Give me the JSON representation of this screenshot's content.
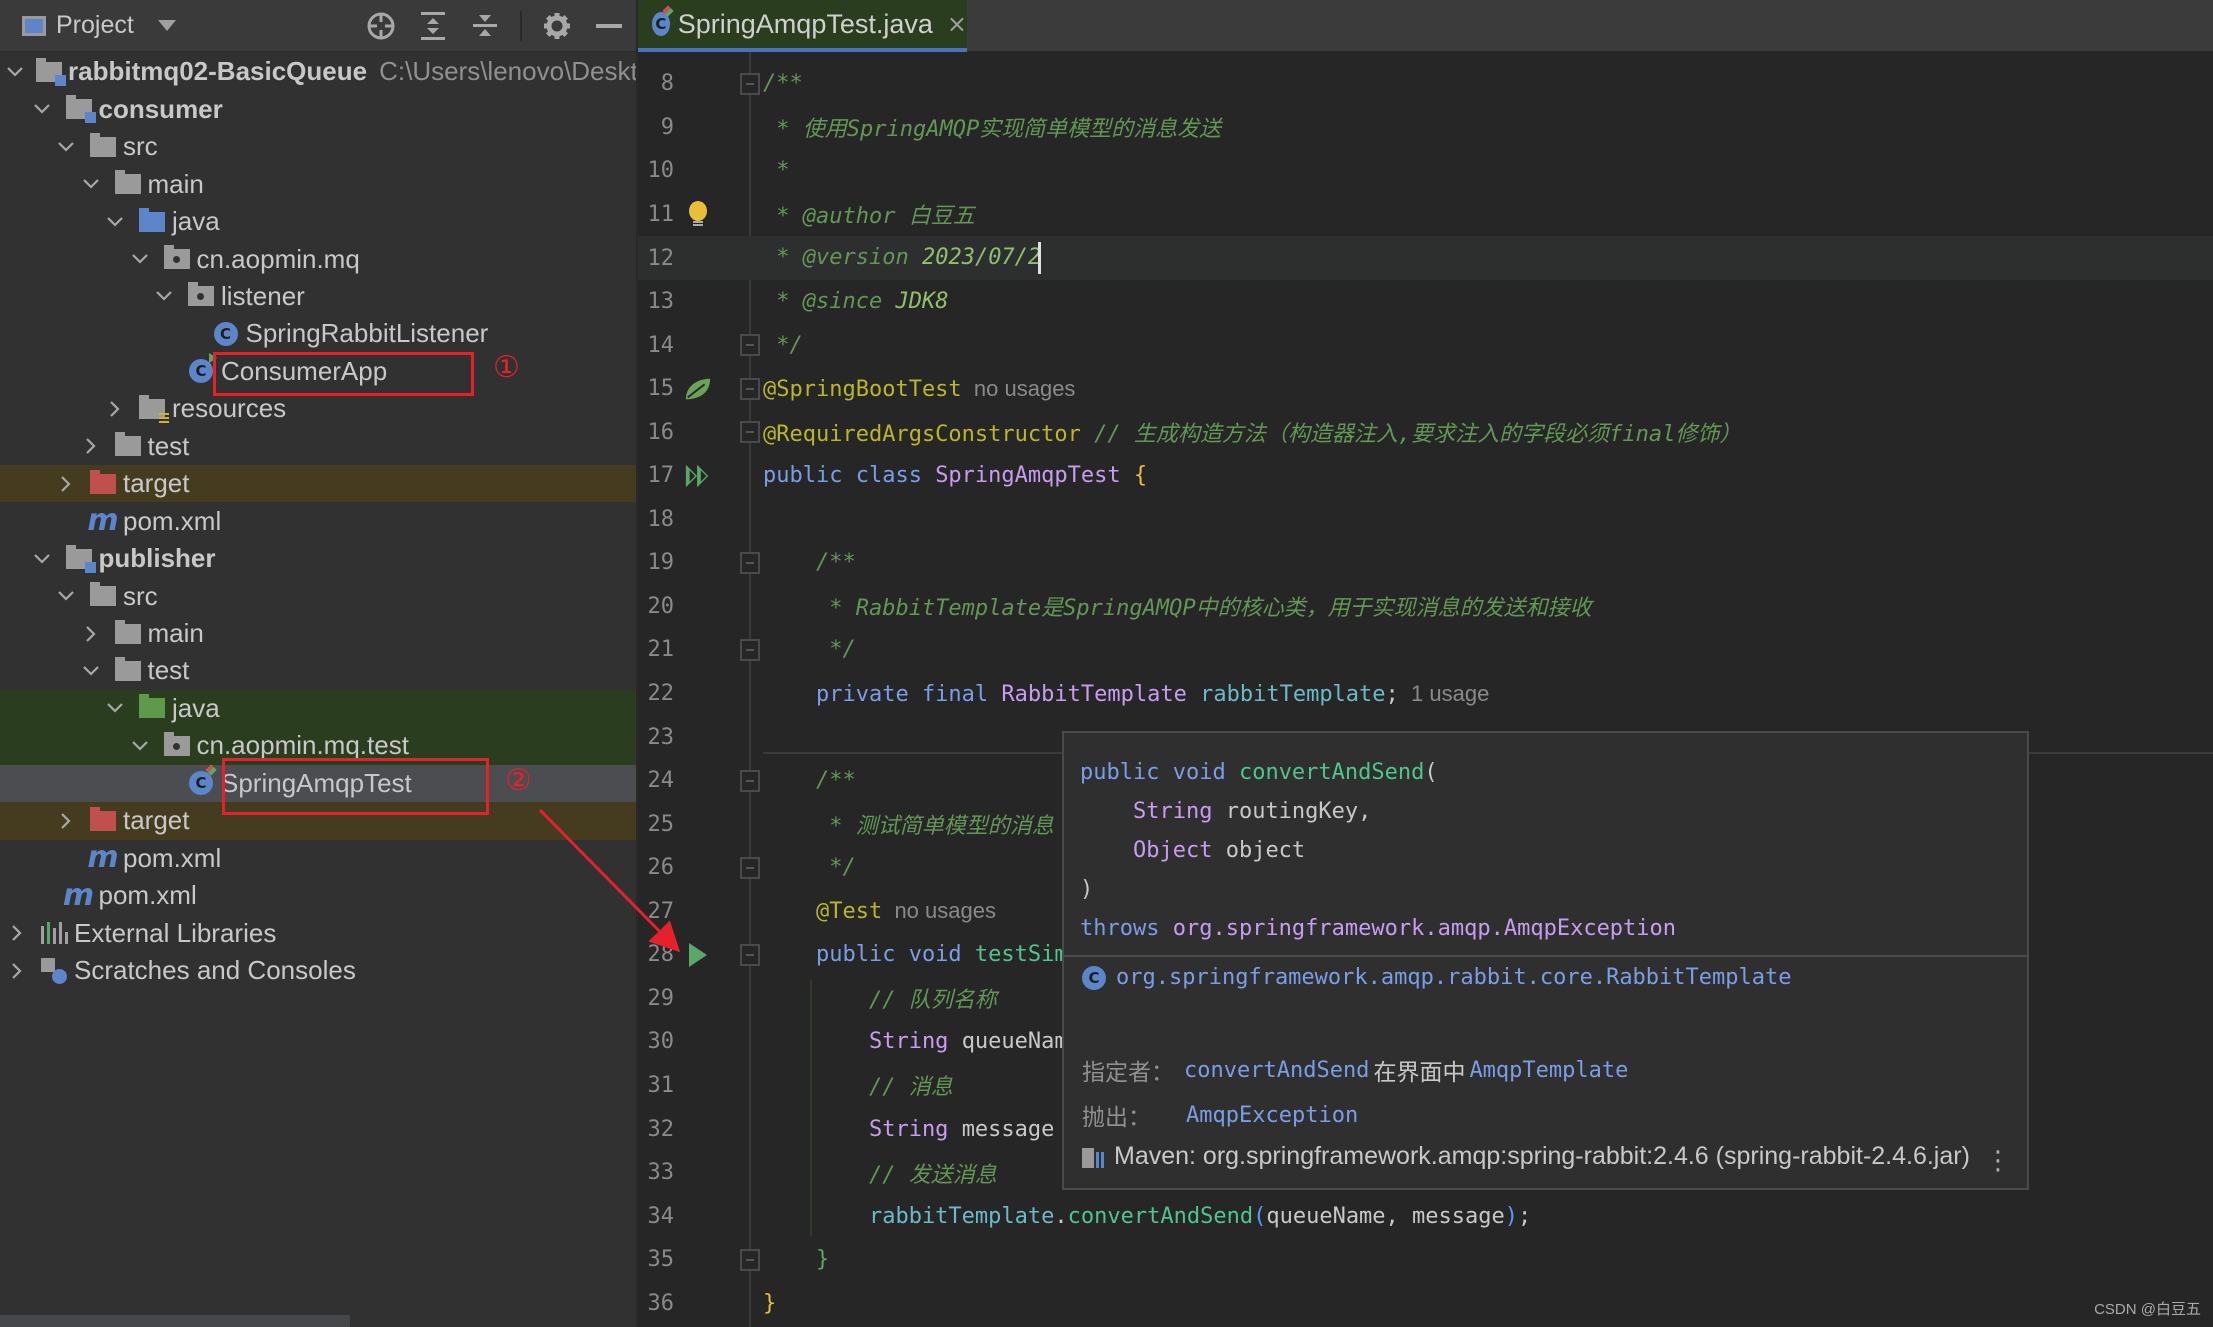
{
  "sidebar": {
    "title": "Project",
    "tools": [
      "select-opened-file",
      "expand-all",
      "collapse-all",
      "options",
      "hide"
    ],
    "tree": [
      {
        "label": "rabbitmq02-BasicQueue",
        "hint": "C:\\Users\\lenovo\\Deskt",
        "depth": 0,
        "arrow": "down",
        "icon": "module",
        "bold": true
      },
      {
        "label": "consumer",
        "depth": 1,
        "arrow": "down",
        "icon": "module",
        "bold": true
      },
      {
        "label": "src",
        "depth": 2,
        "arrow": "down",
        "icon": "folder"
      },
      {
        "label": "main",
        "depth": 3,
        "arrow": "down",
        "icon": "folder"
      },
      {
        "label": "java",
        "depth": 4,
        "arrow": "down",
        "icon": "folder-blue"
      },
      {
        "label": "cn.aopmin.mq",
        "depth": 5,
        "arrow": "down",
        "icon": "package"
      },
      {
        "label": "listener",
        "depth": 6,
        "arrow": "down",
        "icon": "package"
      },
      {
        "label": "SpringRabbitListener",
        "depth": 7,
        "arrow": "none",
        "icon": "class"
      },
      {
        "label": "ConsumerApp",
        "depth": 6,
        "arrow": "none",
        "icon": "class-run"
      },
      {
        "label": "resources",
        "depth": 4,
        "arrow": "right",
        "icon": "resources"
      },
      {
        "label": "test",
        "depth": 3,
        "arrow": "right",
        "icon": "folder"
      },
      {
        "label": "target",
        "depth": 2,
        "arrow": "right",
        "icon": "folder-red",
        "state": "excluded"
      },
      {
        "label": "pom.xml",
        "depth": 2,
        "arrow": "none",
        "icon": "maven"
      },
      {
        "label": "publisher",
        "depth": 1,
        "arrow": "down",
        "icon": "module",
        "bold": true
      },
      {
        "label": "src",
        "depth": 2,
        "arrow": "down",
        "icon": "folder"
      },
      {
        "label": "main",
        "depth": 3,
        "arrow": "right",
        "icon": "folder"
      },
      {
        "label": "test",
        "depth": 3,
        "arrow": "down",
        "icon": "folder"
      },
      {
        "label": "java",
        "depth": 4,
        "arrow": "down",
        "icon": "folder-green",
        "state": "testroot"
      },
      {
        "label": "cn.aopmin.mq.test",
        "depth": 5,
        "arrow": "down",
        "icon": "package",
        "state": "testroot"
      },
      {
        "label": "SpringAmqpTest",
        "depth": 6,
        "arrow": "none",
        "icon": "class-test",
        "state": "selected"
      },
      {
        "label": "target",
        "depth": 2,
        "arrow": "right",
        "icon": "folder-red",
        "state": "excluded"
      },
      {
        "label": "pom.xml",
        "depth": 2,
        "arrow": "none",
        "icon": "maven"
      },
      {
        "label": "pom.xml",
        "depth": 1,
        "arrow": "none",
        "icon": "maven"
      },
      {
        "label": "External Libraries",
        "depth": 0,
        "arrow": "right",
        "icon": "libraries"
      },
      {
        "label": "Scratches and Consoles",
        "depth": 0,
        "arrow": "right",
        "icon": "scratches"
      }
    ],
    "annotations": [
      {
        "target": "ConsumerApp",
        "number": "①"
      },
      {
        "target": "SpringAmqpTest",
        "number": "②"
      }
    ]
  },
  "editor": {
    "tab": {
      "label": "SpringAmqpTest.java",
      "close": "×",
      "icon_letter": "C"
    },
    "lines": [
      {
        "n": "8",
        "fold": "start",
        "segs": [
          [
            "c-com",
            "/**"
          ]
        ]
      },
      {
        "n": "9",
        "segs": [
          [
            "c-com",
            " * 使用SpringAMQP实现简单模型的消息发送"
          ]
        ]
      },
      {
        "n": "10",
        "segs": [
          [
            "c-com",
            " *"
          ]
        ]
      },
      {
        "n": "11",
        "gutter": "bulb",
        "segs": [
          [
            "c-com",
            " * "
          ],
          [
            "c-tag",
            "@author"
          ],
          [
            "c-com",
            " 白豆五"
          ]
        ]
      },
      {
        "n": "12",
        "current": true,
        "caret": true,
        "segs": [
          [
            "c-com",
            " * "
          ],
          [
            "c-tag",
            "@version"
          ],
          [
            "c-tagval",
            " 2023/07/2"
          ]
        ]
      },
      {
        "n": "13",
        "segs": [
          [
            "c-com",
            " * "
          ],
          [
            "c-tag",
            "@since"
          ],
          [
            "c-tagval",
            " JDK8"
          ]
        ]
      },
      {
        "n": "14",
        "fold": "end",
        "segs": [
          [
            "c-com",
            " */"
          ]
        ]
      },
      {
        "n": "15",
        "gutter": "spring",
        "fold": "start",
        "segs": [
          [
            "c-ann",
            "@SpringBootTest"
          ],
          [
            "c-hint",
            "  no usages"
          ]
        ]
      },
      {
        "n": "16",
        "fold": "end",
        "segs": [
          [
            "c-ann",
            "@RequiredArgsConstructor"
          ],
          [
            "c-com",
            " // 生成构造方法（构造器注入,要求注入的字段必须final修饰）"
          ]
        ]
      },
      {
        "n": "17",
        "gutter": "run-all",
        "segs": [
          [
            "c-kw",
            "public class "
          ],
          [
            "c-type",
            "SpringAmqpTest "
          ],
          [
            "c-brace",
            "{"
          ]
        ]
      },
      {
        "n": "18",
        "segs": []
      },
      {
        "n": "19",
        "fold": "start",
        "segs": [
          [
            "c-com",
            "    /**"
          ]
        ]
      },
      {
        "n": "20",
        "segs": [
          [
            "c-com",
            "     * RabbitTemplate是SpringAMQP中的核心类，用于实现消息的发送和接收"
          ]
        ]
      },
      {
        "n": "21",
        "fold": "end",
        "segs": [
          [
            "c-com",
            "     */"
          ]
        ]
      },
      {
        "n": "22",
        "segs": [
          [
            "c-kw",
            "    private final "
          ],
          [
            "c-type",
            "RabbitTemplate "
          ],
          [
            "c-field",
            "rabbitTemplate"
          ],
          [
            "c-txt",
            ";"
          ],
          [
            "c-hint",
            "  1 usage"
          ]
        ]
      },
      {
        "n": "23",
        "segs": []
      },
      {
        "n": "24",
        "fold": "start",
        "segs": [
          [
            "c-com",
            "    /**"
          ]
        ]
      },
      {
        "n": "25",
        "segs": [
          [
            "c-com",
            "     * 测试简单模型的消息"
          ]
        ]
      },
      {
        "n": "26",
        "fold": "end",
        "segs": [
          [
            "c-com",
            "     */"
          ]
        ]
      },
      {
        "n": "27",
        "segs": [
          [
            "c-ann",
            "    @Test"
          ],
          [
            "c-hint",
            "  no usages"
          ]
        ]
      },
      {
        "n": "28",
        "gutter": "run",
        "fold": "start",
        "segs": [
          [
            "c-kw",
            "    public void "
          ],
          [
            "c-meth",
            "testSim"
          ]
        ]
      },
      {
        "n": "29",
        "segs": [
          [
            "c-com",
            "        // 队列名称"
          ]
        ]
      },
      {
        "n": "30",
        "segs": [
          [
            "c-type",
            "        String "
          ],
          [
            "c-txt",
            "queueNam"
          ]
        ]
      },
      {
        "n": "31",
        "segs": [
          [
            "c-com",
            "        // 消息"
          ]
        ]
      },
      {
        "n": "32",
        "segs": [
          [
            "c-type",
            "        String "
          ],
          [
            "c-txt",
            "message"
          ]
        ]
      },
      {
        "n": "33",
        "segs": [
          [
            "c-com",
            "        // 发送消息"
          ]
        ]
      },
      {
        "n": "34",
        "segs": [
          [
            "c-field",
            "        rabbitTemplate"
          ],
          [
            "c-txt",
            "."
          ],
          [
            "c-meth",
            "convertAndSend"
          ],
          [
            "c-paren",
            "("
          ],
          [
            "c-txt",
            "queueName, message"
          ],
          [
            "c-paren",
            ")"
          ],
          [
            "c-txt",
            ";"
          ]
        ]
      },
      {
        "n": "35",
        "fold": "end",
        "segs": [
          [
            "c-brace2",
            "    }"
          ]
        ]
      },
      {
        "n": "36",
        "segs": [
          [
            "c-brace",
            "}"
          ]
        ]
      }
    ]
  },
  "popup": {
    "signature": [
      [
        [
          "c-kw",
          "public void "
        ],
        [
          "c-meth",
          "convertAndSend"
        ],
        [
          "c-txt",
          "("
        ]
      ],
      [
        [
          "c-type",
          "    String "
        ],
        [
          "c-txt",
          "routingKey,"
        ]
      ],
      [
        [
          "c-type",
          "    Object "
        ],
        [
          "c-txt",
          "object"
        ]
      ],
      [
        [
          "c-txt",
          ")"
        ]
      ],
      [
        [
          "c-kw",
          "throws "
        ],
        [
          "c-type",
          "org.springframework.amqp.AmqpException"
        ]
      ]
    ],
    "owner_class": "org.springframework.amqp.rabbit.core.RabbitTemplate",
    "specified_label": "指定者：",
    "specified_method": "convertAndSend",
    "specified_in": "在界面中",
    "specified_interface": "AmqpTemplate",
    "throws_label": "抛出：",
    "throws_value": "AmqpException",
    "maven": "Maven: org.springframework.amqp:spring-rabbit:2.4.6 (spring-rabbit-2.4.6.jar)",
    "more": "⋮"
  },
  "watermark": "CSDN @白豆五",
  "colors": {
    "annotation_red": "#e5212c",
    "selection": "#4b4d51",
    "tab_accent": "#4a72b8"
  }
}
